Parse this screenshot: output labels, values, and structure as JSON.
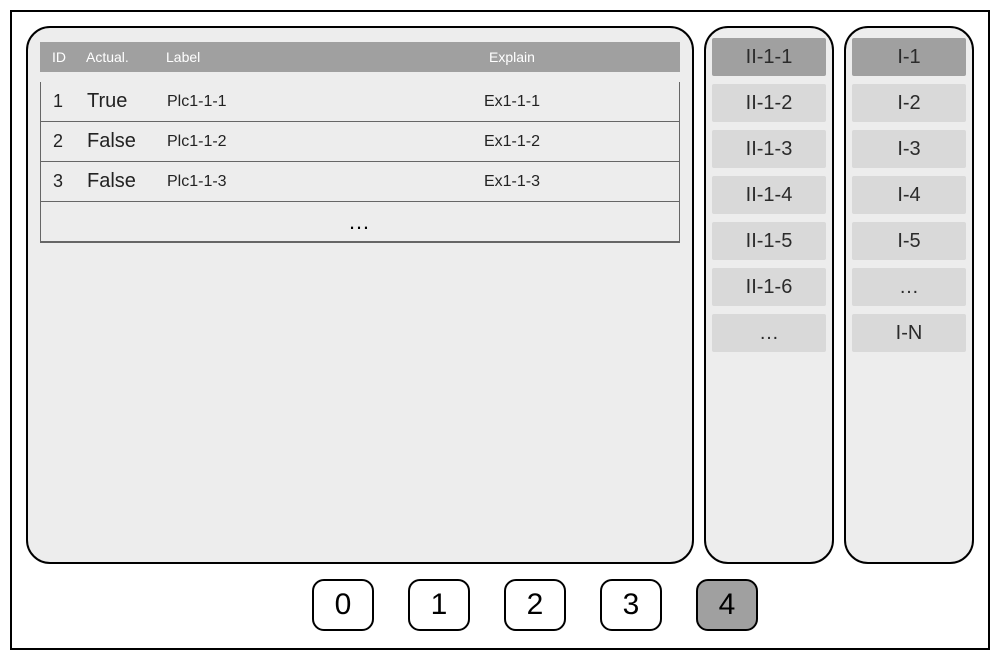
{
  "table": {
    "headers": {
      "id": "ID",
      "actual": "Actual.",
      "label": "Label",
      "explain": "Explain"
    },
    "rows": [
      {
        "id": "1",
        "actual": "True",
        "label": "Plc1-1-1",
        "explain": "Ex1-1-1"
      },
      {
        "id": "2",
        "actual": "False",
        "label": "Plc1-1-2",
        "explain": "Ex1-1-2"
      },
      {
        "id": "3",
        "actual": "False",
        "label": "Plc1-1-3",
        "explain": "Ex1-1-3"
      }
    ],
    "ellipsis": "…"
  },
  "sideA": {
    "items": [
      {
        "label": "II-1-1",
        "selected": true
      },
      {
        "label": "II-1-2",
        "selected": false
      },
      {
        "label": "II-1-3",
        "selected": false
      },
      {
        "label": "II-1-4",
        "selected": false
      },
      {
        "label": "II-1-5",
        "selected": false
      },
      {
        "label": "II-1-6",
        "selected": false
      },
      {
        "label": "…",
        "selected": false
      }
    ]
  },
  "sideB": {
    "items": [
      {
        "label": "I-1",
        "selected": true
      },
      {
        "label": "I-2",
        "selected": false
      },
      {
        "label": "I-3",
        "selected": false
      },
      {
        "label": "I-4",
        "selected": false
      },
      {
        "label": "I-5",
        "selected": false
      },
      {
        "label": "…",
        "selected": false
      },
      {
        "label": "I-N",
        "selected": false
      }
    ]
  },
  "bottom": {
    "buttons": [
      {
        "label": "0",
        "active": false
      },
      {
        "label": "1",
        "active": false
      },
      {
        "label": "2",
        "active": false
      },
      {
        "label": "3",
        "active": false
      },
      {
        "label": "4",
        "active": true
      }
    ]
  }
}
